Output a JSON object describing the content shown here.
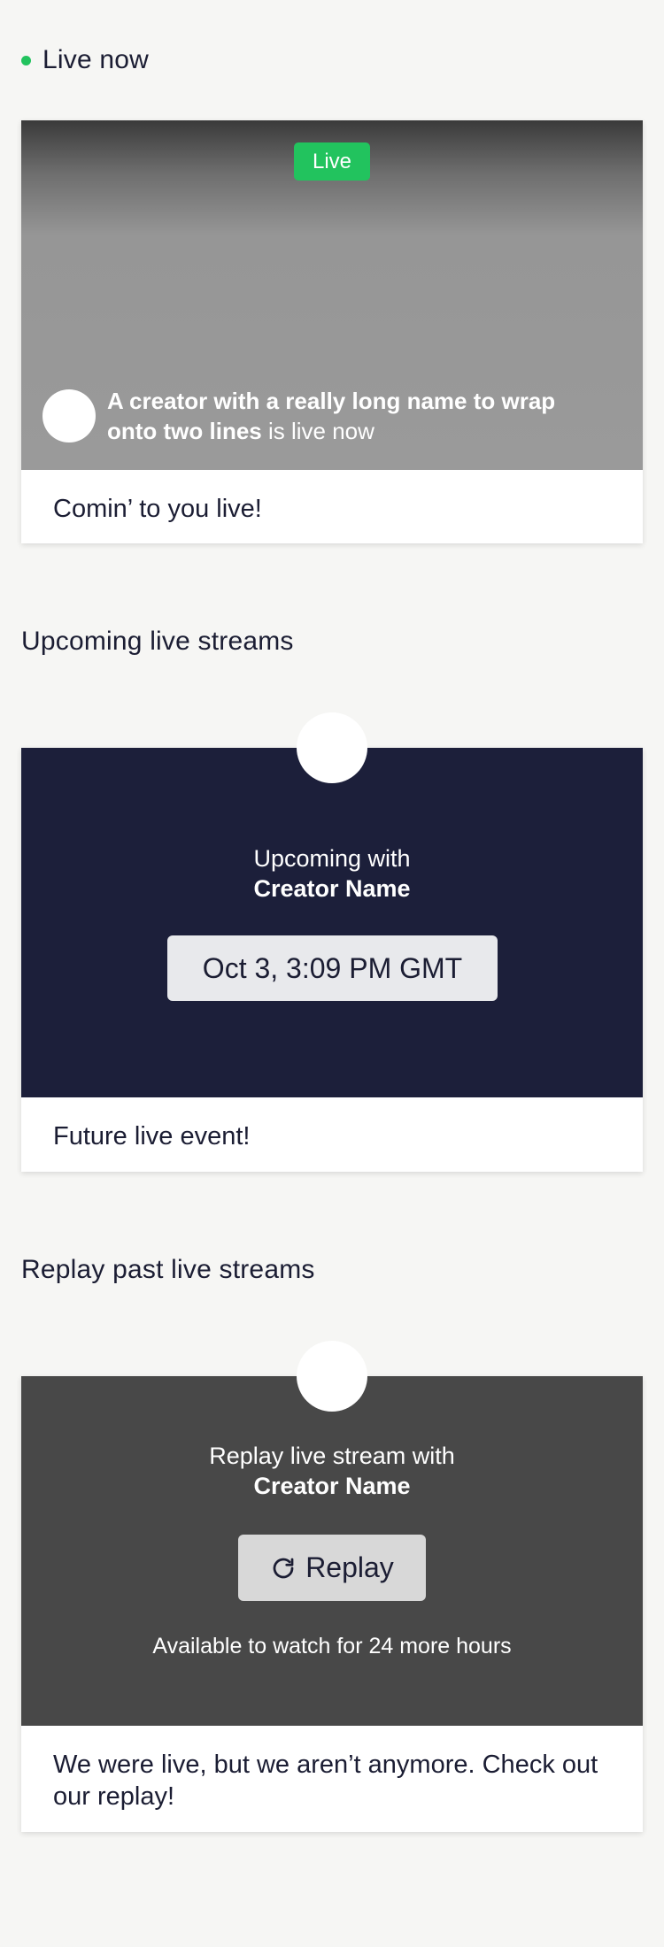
{
  "live_now": {
    "heading": "Live now",
    "badge": "Live",
    "creator_name": "A creator with a really long name to wrap onto two lines",
    "creator_suffix": " is live now",
    "caption": "Comin’ to you live!"
  },
  "upcoming": {
    "heading": "Upcoming live streams",
    "prefix": "Upcoming with",
    "creator_name": "Creator Name",
    "date": "Oct 3, 3:09 PM GMT",
    "caption": "Future live event!"
  },
  "replay": {
    "heading": "Replay past live streams",
    "prefix": "Replay live stream with",
    "creator_name": "Creator Name",
    "button_label": "Replay",
    "availability": "Available to watch for 24 more hours",
    "caption": "We were live, but we aren’t anymore. Check out our replay!"
  },
  "colors": {
    "live_green": "#22c35e",
    "upcoming_bg": "#1c1f3a",
    "replay_bg": "#484848",
    "page_bg": "#f6f6f4"
  },
  "icons": {
    "replay": "refresh-icon",
    "live_indicator": "live-dot-icon"
  }
}
